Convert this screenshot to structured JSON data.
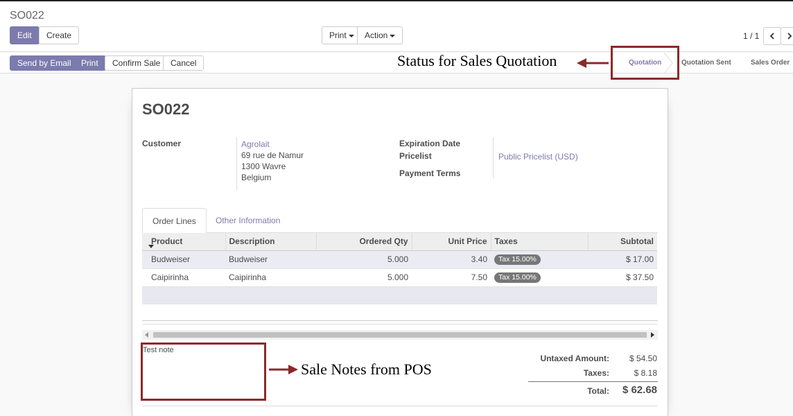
{
  "breadcrumb": "SO022",
  "toolbar": {
    "edit_label": "Edit",
    "create_label": "Create",
    "print_label": "Print",
    "action_label": "Action",
    "pager": "1 / 1"
  },
  "header_buttons": {
    "send_email": "Send by Email",
    "print": "Print",
    "confirm": "Confirm Sale",
    "cancel": "Cancel"
  },
  "statusbar": {
    "stages": [
      "Quotation",
      "Quotation Sent",
      "Sales Order"
    ],
    "active": "Quotation"
  },
  "annotations": {
    "status": "Status for Sales Quotation",
    "notes": "Sale Notes from POS",
    "color": "#8b2a2a"
  },
  "form": {
    "title": "SO022",
    "customer_label": "Customer",
    "customer_name": "Agrolait",
    "address": [
      "69 rue de Namur",
      "1300 Wavre",
      "Belgium"
    ],
    "expiration_label": "Expiration Date",
    "pricelist_label": "Pricelist",
    "pricelist_value": "Public Pricelist (USD)",
    "payment_terms_label": "Payment Terms"
  },
  "tabs": [
    "Order Lines",
    "Other Information"
  ],
  "order_lines": {
    "columns": [
      "Product",
      "Description",
      "Ordered Qty",
      "Unit Price",
      "Taxes",
      "Subtotal"
    ],
    "rows": [
      {
        "product": "Budweiser",
        "description": "Budweiser",
        "qty": "5.000",
        "unit_price": "3.40",
        "tax": "Tax 15.00%",
        "subtotal": "$ 17.00"
      },
      {
        "product": "Caipirinha",
        "description": "Caipirinha",
        "qty": "5.000",
        "unit_price": "7.50",
        "tax": "Tax 15.00%",
        "subtotal": "$ 37.50"
      }
    ]
  },
  "note": "Test note",
  "totals": {
    "untaxed_label": "Untaxed Amount:",
    "untaxed_value": "$ 54.50",
    "taxes_label": "Taxes:",
    "taxes_value": "$ 8.18",
    "total_label": "Total:",
    "total_value": "$ 62.68"
  },
  "colors": {
    "brand": "#7c7bad",
    "annotation_red": "#8b2a2a"
  }
}
